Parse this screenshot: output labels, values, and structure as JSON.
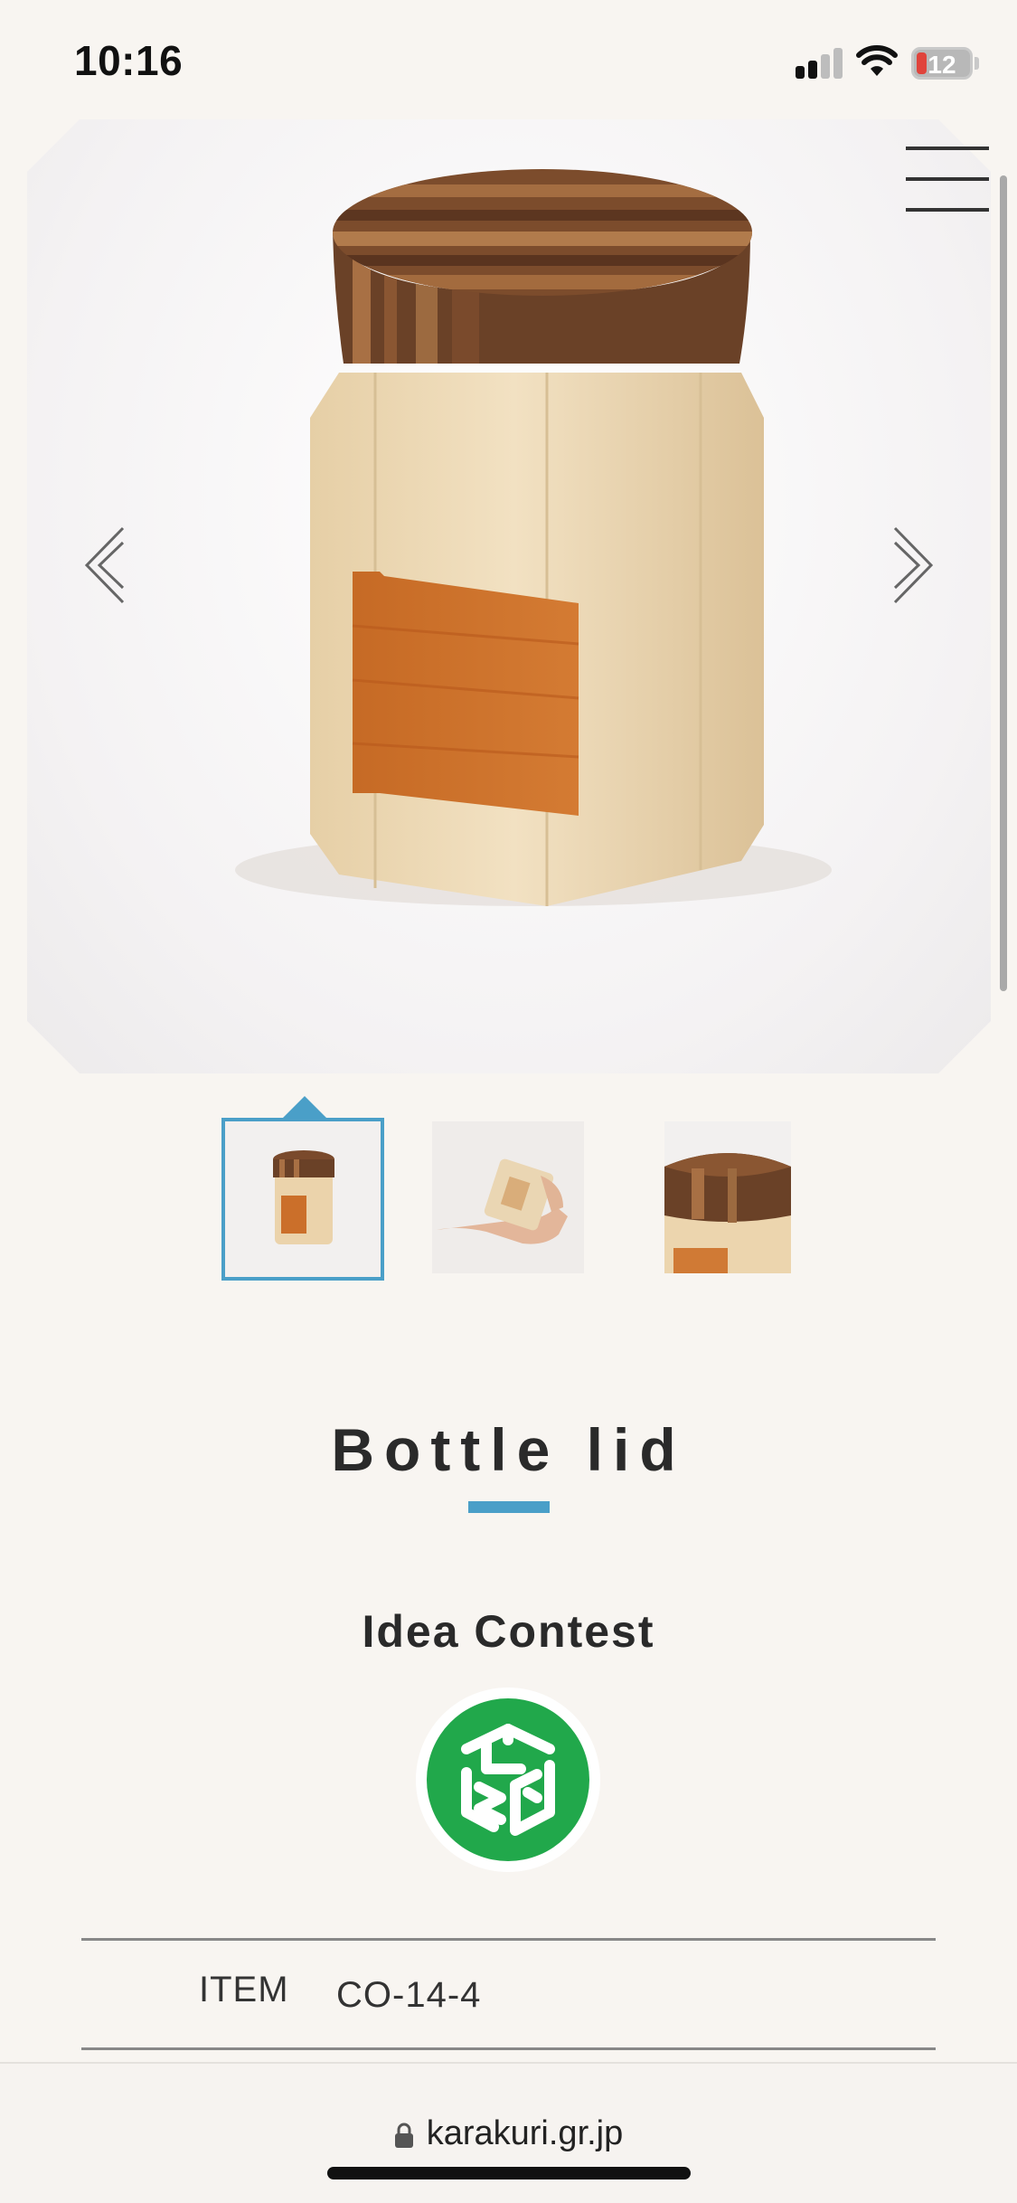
{
  "status_bar": {
    "time": "10:16",
    "battery_level": "12",
    "icons": [
      "signal-icon",
      "wifi-icon",
      "battery-icon"
    ]
  },
  "hero": {
    "icons": [
      "menu-icon",
      "chevron-left-icon",
      "chevron-right-icon"
    ],
    "active_image_index": 0,
    "image_count": 3
  },
  "product": {
    "title": "Bottle lid",
    "contest_label": "Idea Contest",
    "details": [
      {
        "label": "ITEM",
        "value": "CO-14-4"
      }
    ]
  },
  "browser": {
    "url": "karakuri.gr.jp",
    "icons": [
      "lock-icon"
    ]
  },
  "colors": {
    "accent": "#4a9fc8",
    "logo_green": "#21a84b",
    "background": "#f8f5f1"
  }
}
